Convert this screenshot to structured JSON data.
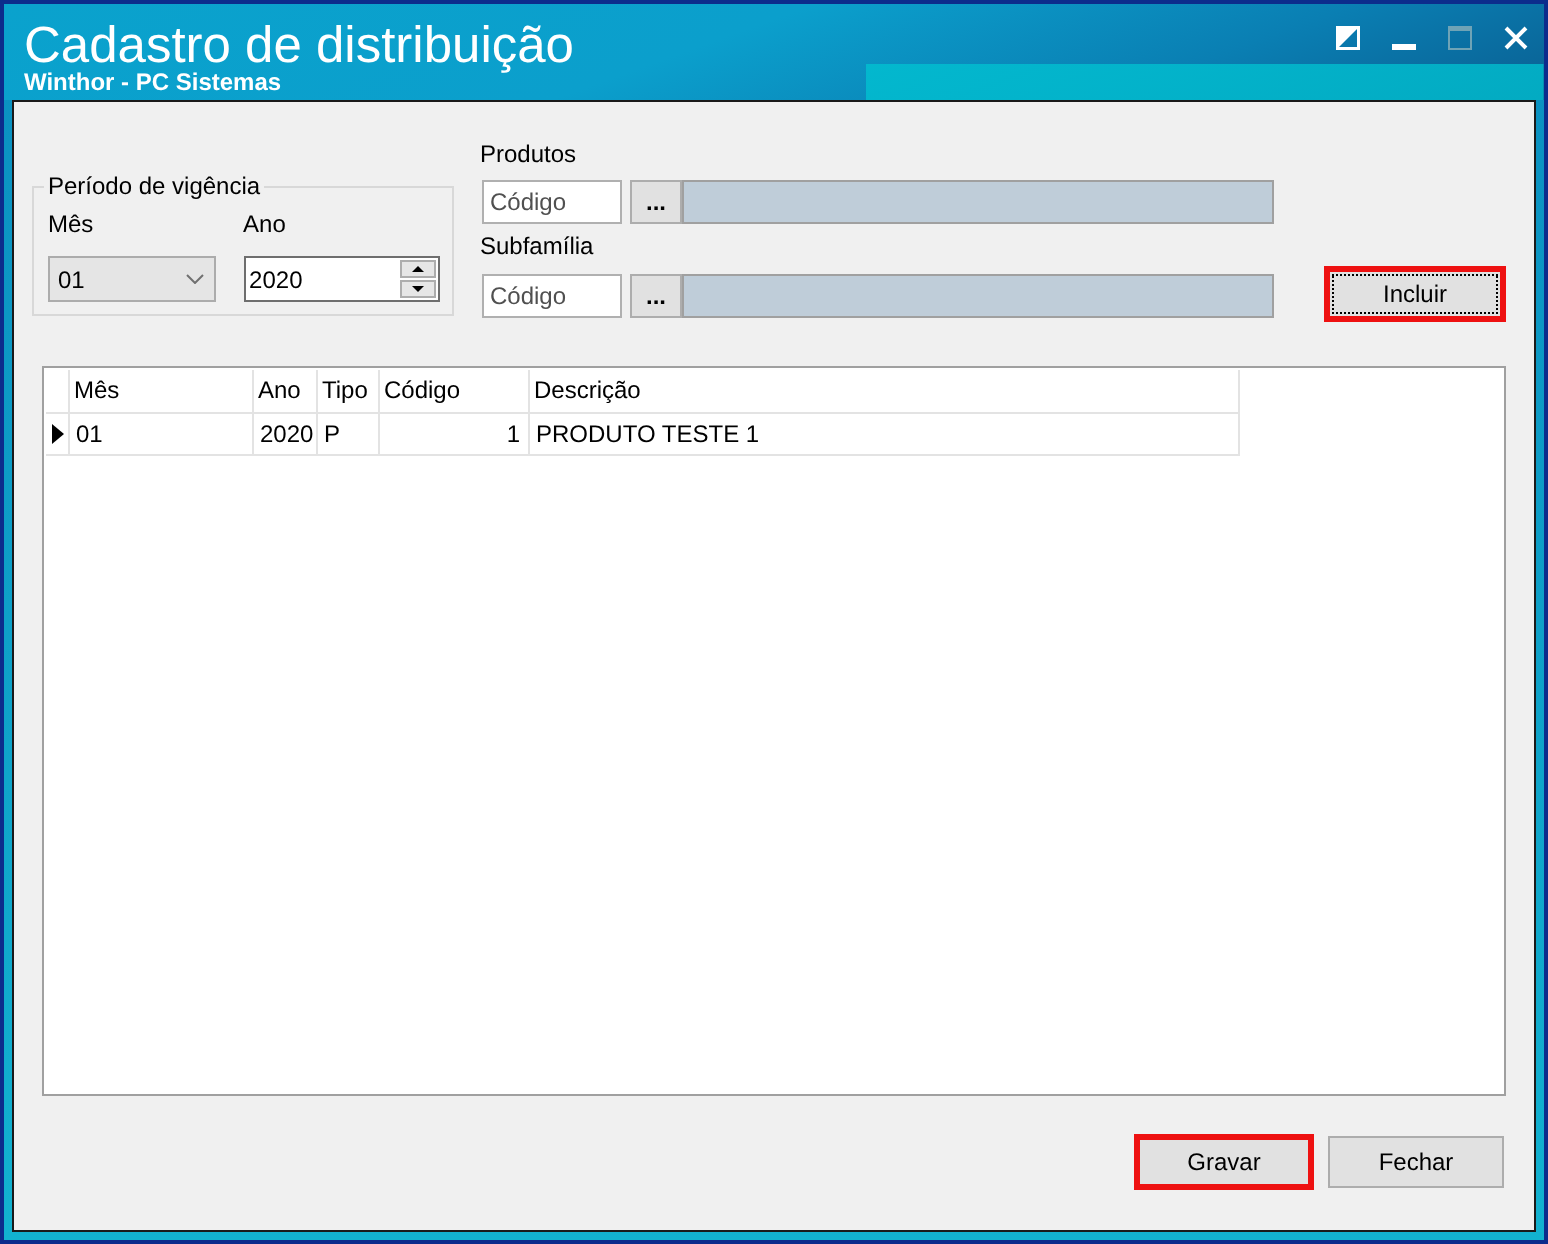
{
  "window": {
    "title": "Cadastro de distribuição",
    "subtitle": "Winthor - PC Sistemas"
  },
  "window_buttons": [
    {
      "kind": "contrast",
      "disabled": false
    },
    {
      "kind": "minimize",
      "disabled": false
    },
    {
      "kind": "maximize",
      "disabled": true
    },
    {
      "kind": "close",
      "disabled": false
    }
  ],
  "period": {
    "legend": "Período de vigência",
    "month": {
      "label": "Mês",
      "value": "01"
    },
    "year": {
      "label": "Ano",
      "value": "2020"
    }
  },
  "lookups": [
    {
      "label": "Produtos",
      "placeholder": "Código",
      "button": "..."
    },
    {
      "label": "Subfamília",
      "placeholder": "Código",
      "button": "..."
    }
  ],
  "include_button": {
    "label": "Incluir",
    "highlighted": true,
    "focused": true
  },
  "table": {
    "columns": [
      "Mês",
      "Ano",
      "Tipo",
      "Código",
      "Descrição"
    ],
    "rows": [
      {
        "selected": true,
        "cells": [
          "01",
          "2020",
          "P",
          "1",
          "PRODUTO TESTE 1"
        ]
      }
    ]
  },
  "footer_buttons": [
    {
      "label": "Gravar",
      "highlighted": true
    },
    {
      "label": "Fechar",
      "highlighted": false
    }
  ]
}
